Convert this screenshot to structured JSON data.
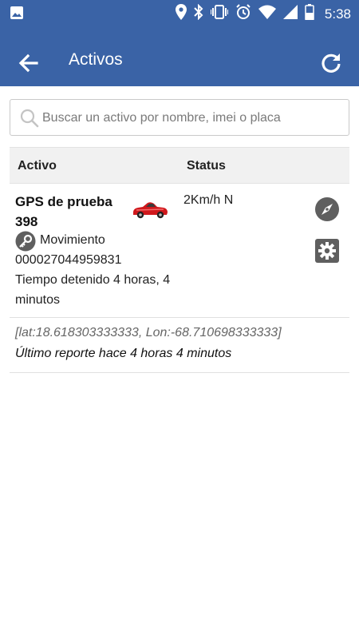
{
  "status_bar": {
    "time": "5:38",
    "icons": [
      "image-icon",
      "location-icon",
      "bluetooth-icon",
      "vibrate-icon",
      "alarm-icon",
      "wifi-icon",
      "signal-icon",
      "battery-icon"
    ]
  },
  "app_bar": {
    "title": "Activos",
    "back_icon": "arrow-left-icon",
    "refresh_icon": "refresh-icon",
    "color": "#3a63a6"
  },
  "search": {
    "placeholder": "Buscar un activo por nombre, imei o placa",
    "value": ""
  },
  "table": {
    "headers": {
      "asset": "Activo",
      "status": "Status"
    },
    "rows": [
      {
        "name": "GPS de prueba 398",
        "vehicle_icon": "red-car-icon",
        "status": "2Km/h N",
        "movement": "Movimiento",
        "imei": "000027044959831",
        "stopped_time": "Tiempo detenido 4 horas, 4 minutos",
        "coords": "[lat:18.618303333333, Lon:-68.710698333333]",
        "last_report": "Último reporte hace 4 horas 4 minutos"
      }
    ]
  },
  "colors": {
    "primary": "#3a63a6",
    "icon_gray": "#5f5f5f",
    "car": "#d0181c"
  }
}
